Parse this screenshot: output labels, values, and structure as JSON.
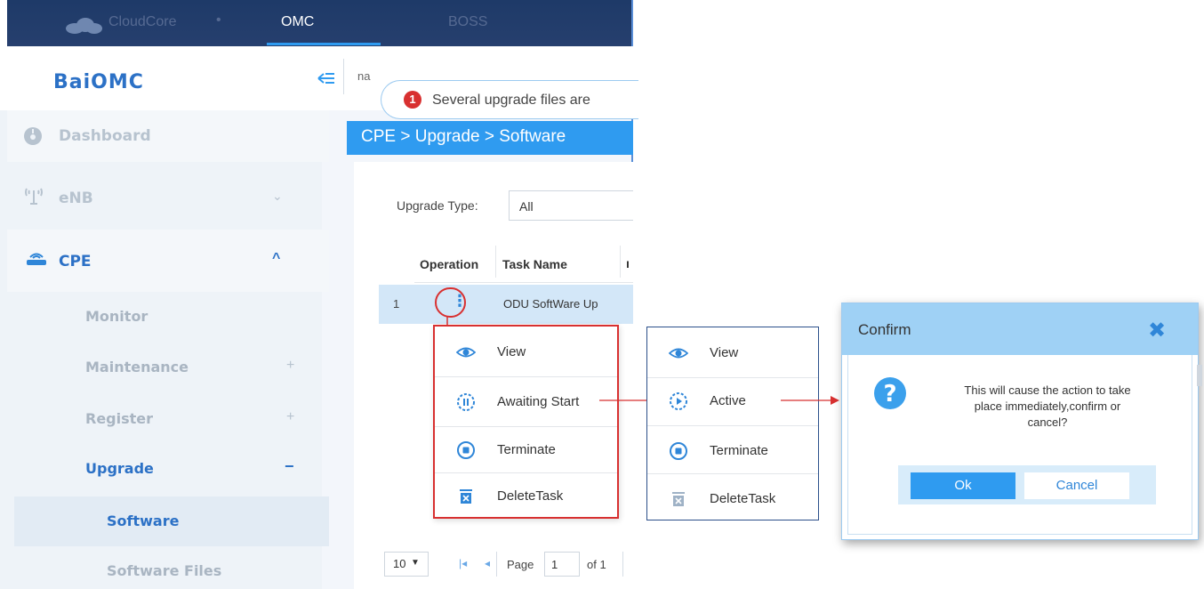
{
  "topbar": {
    "brand": "CloudCore",
    "tabs": [
      "OMC",
      "BOSS"
    ]
  },
  "app": {
    "title": "BaiOMC",
    "search_partial": "na"
  },
  "notification": {
    "badge": "1",
    "text": "Several upgrade files are"
  },
  "sidebar": {
    "items": [
      {
        "label": "Dashboard",
        "icon": "dashboard-icon"
      },
      {
        "label": "eNB",
        "icon": "antenna-icon"
      },
      {
        "label": "CPE",
        "icon": "router-icon"
      }
    ],
    "sub_items": [
      {
        "label": "Monitor",
        "marker": ""
      },
      {
        "label": "Maintenance",
        "marker": "+"
      },
      {
        "label": "Register",
        "marker": "+"
      },
      {
        "label": "Upgrade",
        "marker": "−"
      }
    ],
    "sub_sub_items": [
      {
        "label": "Software"
      },
      {
        "label": "Software Files"
      }
    ]
  },
  "breadcrumb": "CPE > Upgrade > Software",
  "filter": {
    "label": "Upgrade Type:",
    "value": "All"
  },
  "table": {
    "columns": [
      "Operation",
      "Task Name"
    ],
    "rows": [
      {
        "index": "1",
        "task_name": "ODU SoftWare Up"
      }
    ]
  },
  "pagination": {
    "page_size": "10",
    "page_label": "Page",
    "page": "1",
    "of_label": "of 1"
  },
  "menu_primary": {
    "items": [
      {
        "label": "View",
        "icon": "eye-icon"
      },
      {
        "label": "Awaiting Start",
        "icon": "pause-circle-icon"
      },
      {
        "label": "Terminate",
        "icon": "stop-circle-icon"
      },
      {
        "label": "DeleteTask",
        "icon": "trash-icon"
      }
    ]
  },
  "menu_secondary": {
    "items": [
      {
        "label": "View",
        "icon": "eye-icon"
      },
      {
        "label": "Active",
        "icon": "play-circle-icon"
      },
      {
        "label": "Terminate",
        "icon": "stop-circle-icon"
      },
      {
        "label": "DeleteTask",
        "icon": "trash-icon"
      }
    ]
  },
  "dialog": {
    "title": "Confirm",
    "line1": "This will cause the action to take",
    "line2": "place immediately,confirm or",
    "line3": "cancel?",
    "ok_label": "Ok",
    "cancel_label": "Cancel"
  },
  "colors": {
    "accent": "#2f9bf0",
    "highlight_red": "#d83030",
    "topbar": "#1e3a68"
  }
}
